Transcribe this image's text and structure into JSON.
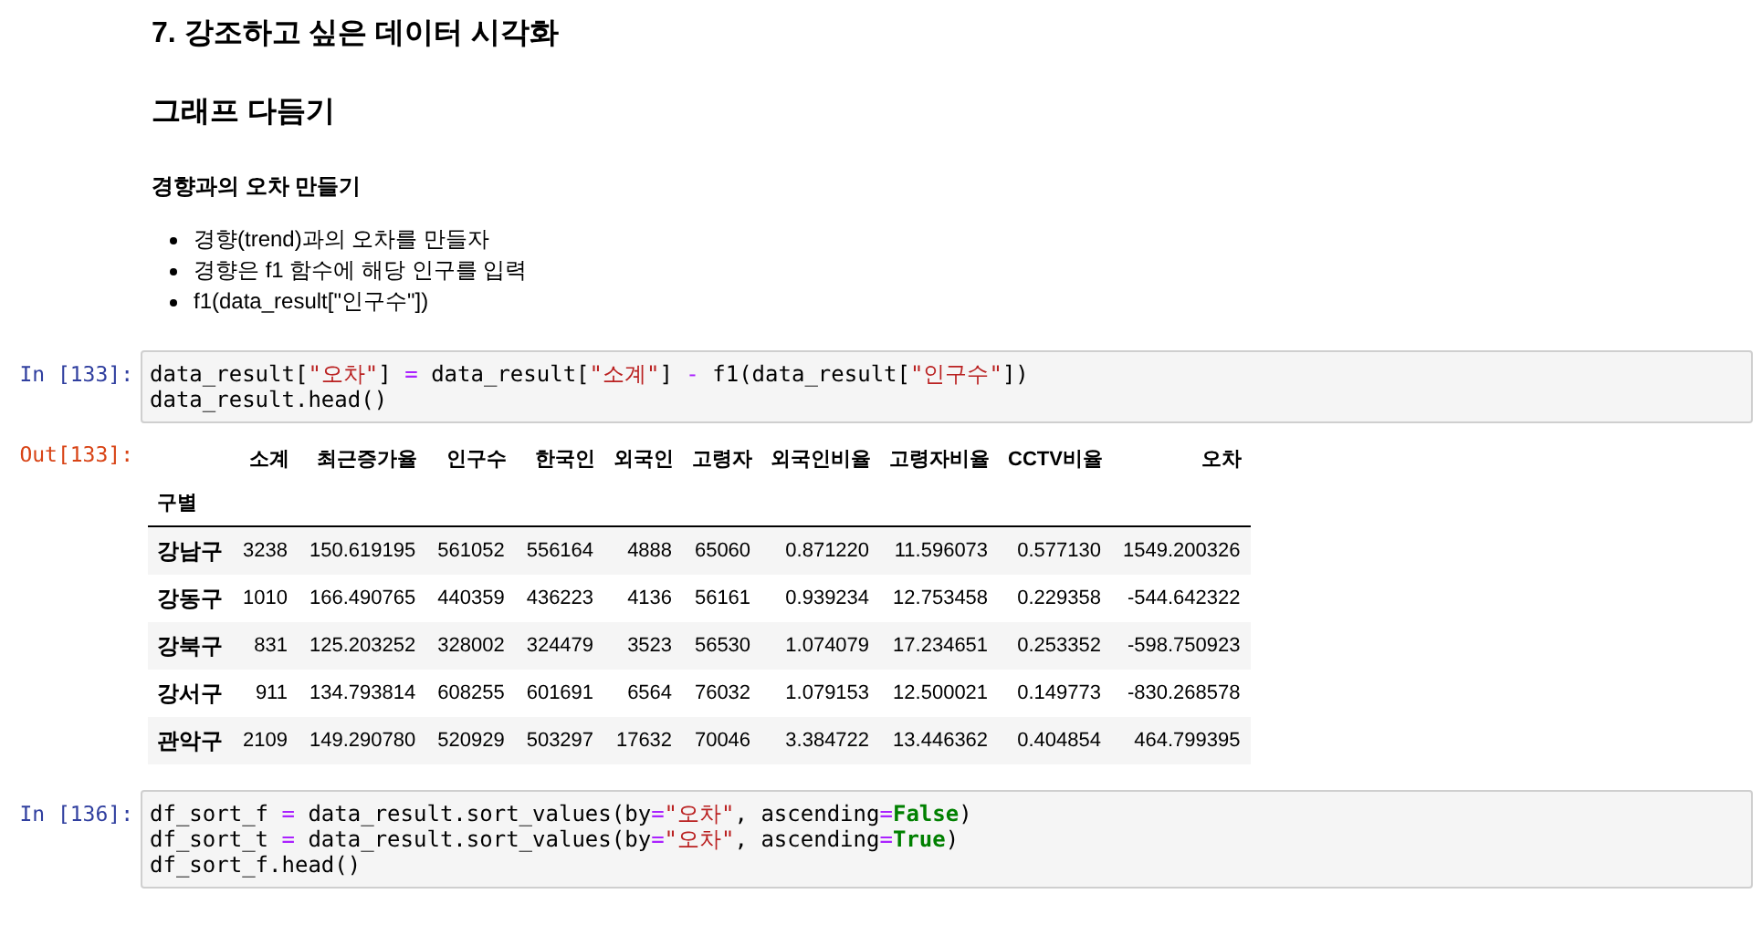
{
  "markdown": {
    "title": "7. 강조하고 싶은 데이터 시각화",
    "subtitle": "그래프 다듬기",
    "section": "경향과의 오차 만들기",
    "bullets": [
      "경향(trend)과의 오차를 만들자",
      "경향은 f1 함수에 해당 인구를 입력",
      "f1(data_result[\"인구수\"])"
    ]
  },
  "cells": [
    {
      "prompt": "In [133]:",
      "kind": "input",
      "lines": [
        [
          {
            "text": "data_result[",
            "kind": "plain"
          },
          {
            "text": "\"오차\"",
            "kind": "string"
          },
          {
            "text": "] ",
            "kind": "plain"
          },
          {
            "text": "=",
            "kind": "op"
          },
          {
            "text": " data_result[",
            "kind": "plain"
          },
          {
            "text": "\"소계\"",
            "kind": "string"
          },
          {
            "text": "] ",
            "kind": "plain"
          },
          {
            "text": "-",
            "kind": "op"
          },
          {
            "text": " f1(data_result[",
            "kind": "plain"
          },
          {
            "text": "\"인구수\"",
            "kind": "string"
          },
          {
            "text": "])",
            "kind": "plain"
          }
        ],
        [
          {
            "text": "data_result.head()",
            "kind": "plain"
          }
        ]
      ]
    },
    {
      "prompt": "Out[133]:",
      "kind": "output",
      "table": {
        "columns": [
          "소계",
          "최근증가율",
          "인구수",
          "한국인",
          "외국인",
          "고령자",
          "외국인비율",
          "고령자비율",
          "CCTV비율",
          "오차"
        ],
        "index_name": "구별",
        "rows": [
          {
            "index": "강남구",
            "cells": [
              "3238",
              "150.619195",
              "561052",
              "556164",
              "4888",
              "65060",
              "0.871220",
              "11.596073",
              "0.577130",
              "1549.200326"
            ]
          },
          {
            "index": "강동구",
            "cells": [
              "1010",
              "166.490765",
              "440359",
              "436223",
              "4136",
              "56161",
              "0.939234",
              "12.753458",
              "0.229358",
              "-544.642322"
            ]
          },
          {
            "index": "강북구",
            "cells": [
              "831",
              "125.203252",
              "328002",
              "324479",
              "3523",
              "56530",
              "1.074079",
              "17.234651",
              "0.253352",
              "-598.750923"
            ]
          },
          {
            "index": "강서구",
            "cells": [
              "911",
              "134.793814",
              "608255",
              "601691",
              "6564",
              "76032",
              "1.079153",
              "12.500021",
              "0.149773",
              "-830.268578"
            ]
          },
          {
            "index": "관악구",
            "cells": [
              "2109",
              "149.290780",
              "520929",
              "503297",
              "17632",
              "70046",
              "3.384722",
              "13.446362",
              "0.404854",
              "464.799395"
            ]
          }
        ]
      }
    },
    {
      "prompt": "In [136]:",
      "kind": "input",
      "lines": [
        [
          {
            "text": "df_sort_f ",
            "kind": "plain"
          },
          {
            "text": "=",
            "kind": "op"
          },
          {
            "text": " data_result.sort_values(by",
            "kind": "plain"
          },
          {
            "text": "=",
            "kind": "op"
          },
          {
            "text": "\"오차\"",
            "kind": "string"
          },
          {
            "text": ", ascending",
            "kind": "plain"
          },
          {
            "text": "=",
            "kind": "op"
          },
          {
            "text": "False",
            "kind": "keyword"
          },
          {
            "text": ")",
            "kind": "plain"
          }
        ],
        [
          {
            "text": "df_sort_t ",
            "kind": "plain"
          },
          {
            "text": "=",
            "kind": "op"
          },
          {
            "text": " data_result.sort_values(by",
            "kind": "plain"
          },
          {
            "text": "=",
            "kind": "op"
          },
          {
            "text": "\"오차\"",
            "kind": "string"
          },
          {
            "text": ", ascending",
            "kind": "plain"
          },
          {
            "text": "=",
            "kind": "op"
          },
          {
            "text": "True",
            "kind": "keyword"
          },
          {
            "text": ")",
            "kind": "plain"
          }
        ],
        [
          {
            "text": "df_sort_f.head()",
            "kind": "plain"
          }
        ]
      ]
    }
  ]
}
